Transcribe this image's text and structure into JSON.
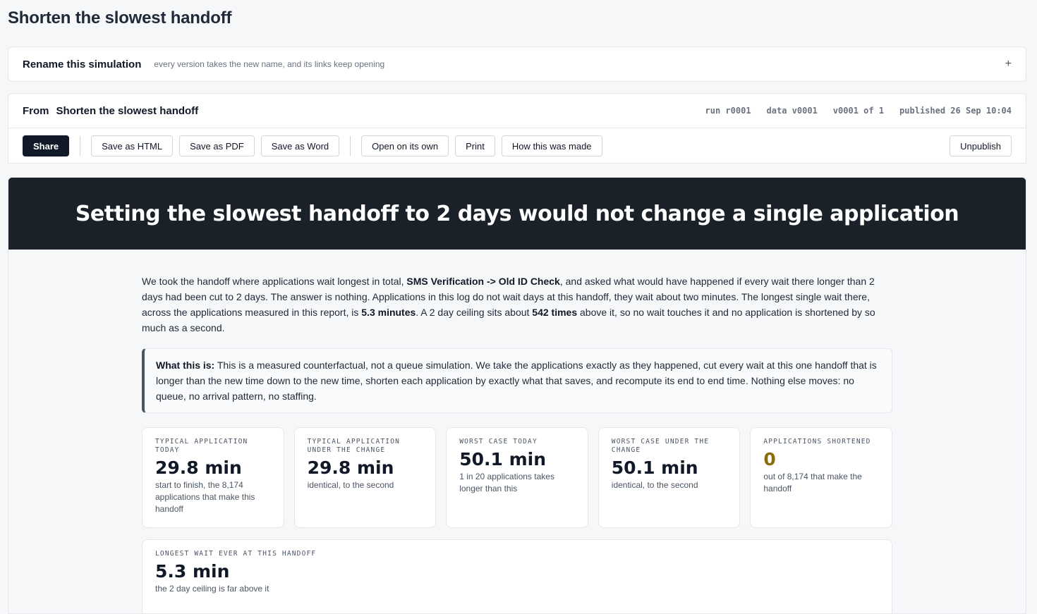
{
  "page": {
    "title": "Shorten the slowest handoff"
  },
  "rename": {
    "title": "Rename this simulation",
    "hint": "every version takes the new name, and its links keep opening",
    "toggle": "+"
  },
  "from": {
    "label": "From",
    "name": "Shorten the slowest handoff",
    "run": "run r0001",
    "data": "data v0001",
    "version": "v0001 of 1",
    "published": "published 26 Sep 10:04"
  },
  "toolbar": {
    "share": "Share",
    "save_html": "Save as HTML",
    "save_pdf": "Save as PDF",
    "save_word": "Save as Word",
    "open_own": "Open on its own",
    "print": "Print",
    "how_made": "How this was made",
    "unpublish": "Unpublish"
  },
  "report": {
    "headline": "Setting the slowest handoff to 2 days would not change a single application",
    "intro": {
      "p1": "We took the handoff where applications wait longest in total, ",
      "handoff": "SMS Verification -> Old ID Check",
      "p2": ", and asked what would have happened if every wait there longer than 2 days had been cut to 2 days. The answer is nothing. Applications in this log do not wait days at this handoff, they wait about two minutes. The longest single wait there, across the applications measured in this report, is ",
      "longest": "5.3 minutes",
      "p3": ". A 2 day ceiling sits about ",
      "times": "542 times",
      "p4": " above it, so no wait touches it and no application is shortened by so much as a second."
    },
    "callout": {
      "label": "What this is:",
      "text": " This is a measured counterfactual, not a queue simulation. We take the applications exactly as they happened, cut every wait at this one handoff that is longer than the new time down to the new time, shorten each application by exactly what that saves, and recompute its end to end time. Nothing else moves: no queue, no arrival pattern, no staffing."
    },
    "cards": [
      {
        "label": "Typical application today",
        "value": "29.8 min",
        "note": "start to finish, the 8,174 applications that make this handoff"
      },
      {
        "label": "Typical application under the change",
        "value": "29.8 min",
        "note": "identical, to the second"
      },
      {
        "label": "Worst case today",
        "value": "50.1 min",
        "note": "1 in 20 applications takes longer than this"
      },
      {
        "label": "Worst case under the change",
        "value": "50.1 min",
        "note": "identical, to the second"
      },
      {
        "label": "Applications shortened",
        "value": "0",
        "note": "out of 8,174 that make the handoff"
      }
    ],
    "wide_card": {
      "label": "Longest wait ever at this handoff",
      "value": "5.3 min",
      "note": "the 2 day ceiling is far above it"
    },
    "accent_color": "#8a6d0b"
  }
}
